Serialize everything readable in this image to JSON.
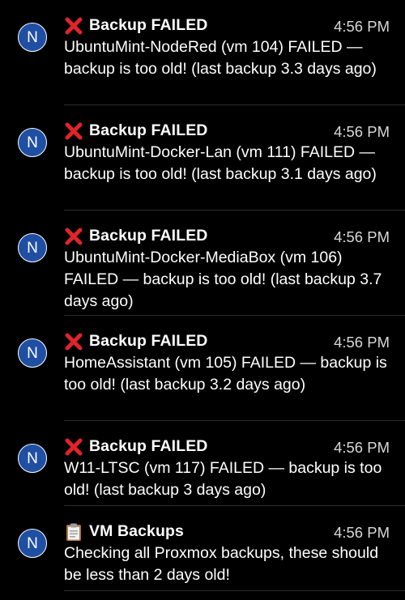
{
  "notifications": [
    {
      "avatar_letter": "N",
      "icon": "red-cross-icon",
      "title": "Backup FAILED",
      "time": "4:56 PM",
      "body": "UbuntuMint-NodeRed (vm 104) FAILED — backup is too old! (last backup 3.3 days ago)"
    },
    {
      "avatar_letter": "N",
      "icon": "red-cross-icon",
      "title": "Backup FAILED",
      "time": "4:56 PM",
      "body": "UbuntuMint-Docker-Lan (vm 111) FAILED — backup is too old! (last backup 3.1 days ago)"
    },
    {
      "avatar_letter": "N",
      "icon": "red-cross-icon",
      "title": "Backup FAILED",
      "time": "4:56 PM",
      "body": "UbuntuMint-Docker-MediaBox (vm 106) FAILED — backup is too old! (last backup 3.7 days ago)"
    },
    {
      "avatar_letter": "N",
      "icon": "red-cross-icon",
      "title": "Backup FAILED",
      "time": "4:56 PM",
      "body": "HomeAssistant (vm 105) FAILED — backup is too old! (last backup 3.2 days ago)"
    },
    {
      "avatar_letter": "N",
      "icon": "red-cross-icon",
      "title": "Backup FAILED",
      "time": "4:56 PM",
      "body": "W11-LTSC (vm 117) FAILED — backup is too old! (last backup 3 days ago)"
    },
    {
      "avatar_letter": "N",
      "icon": "clipboard-icon",
      "title": "VM Backups",
      "time": "4:56 PM",
      "body": "Checking all Proxmox backups, these should be less than 2 days old!"
    }
  ],
  "colors": {
    "background": "#000000",
    "avatar": "#1f4fa3",
    "cross": "#e0242b",
    "divider": "#2c2c2e"
  }
}
